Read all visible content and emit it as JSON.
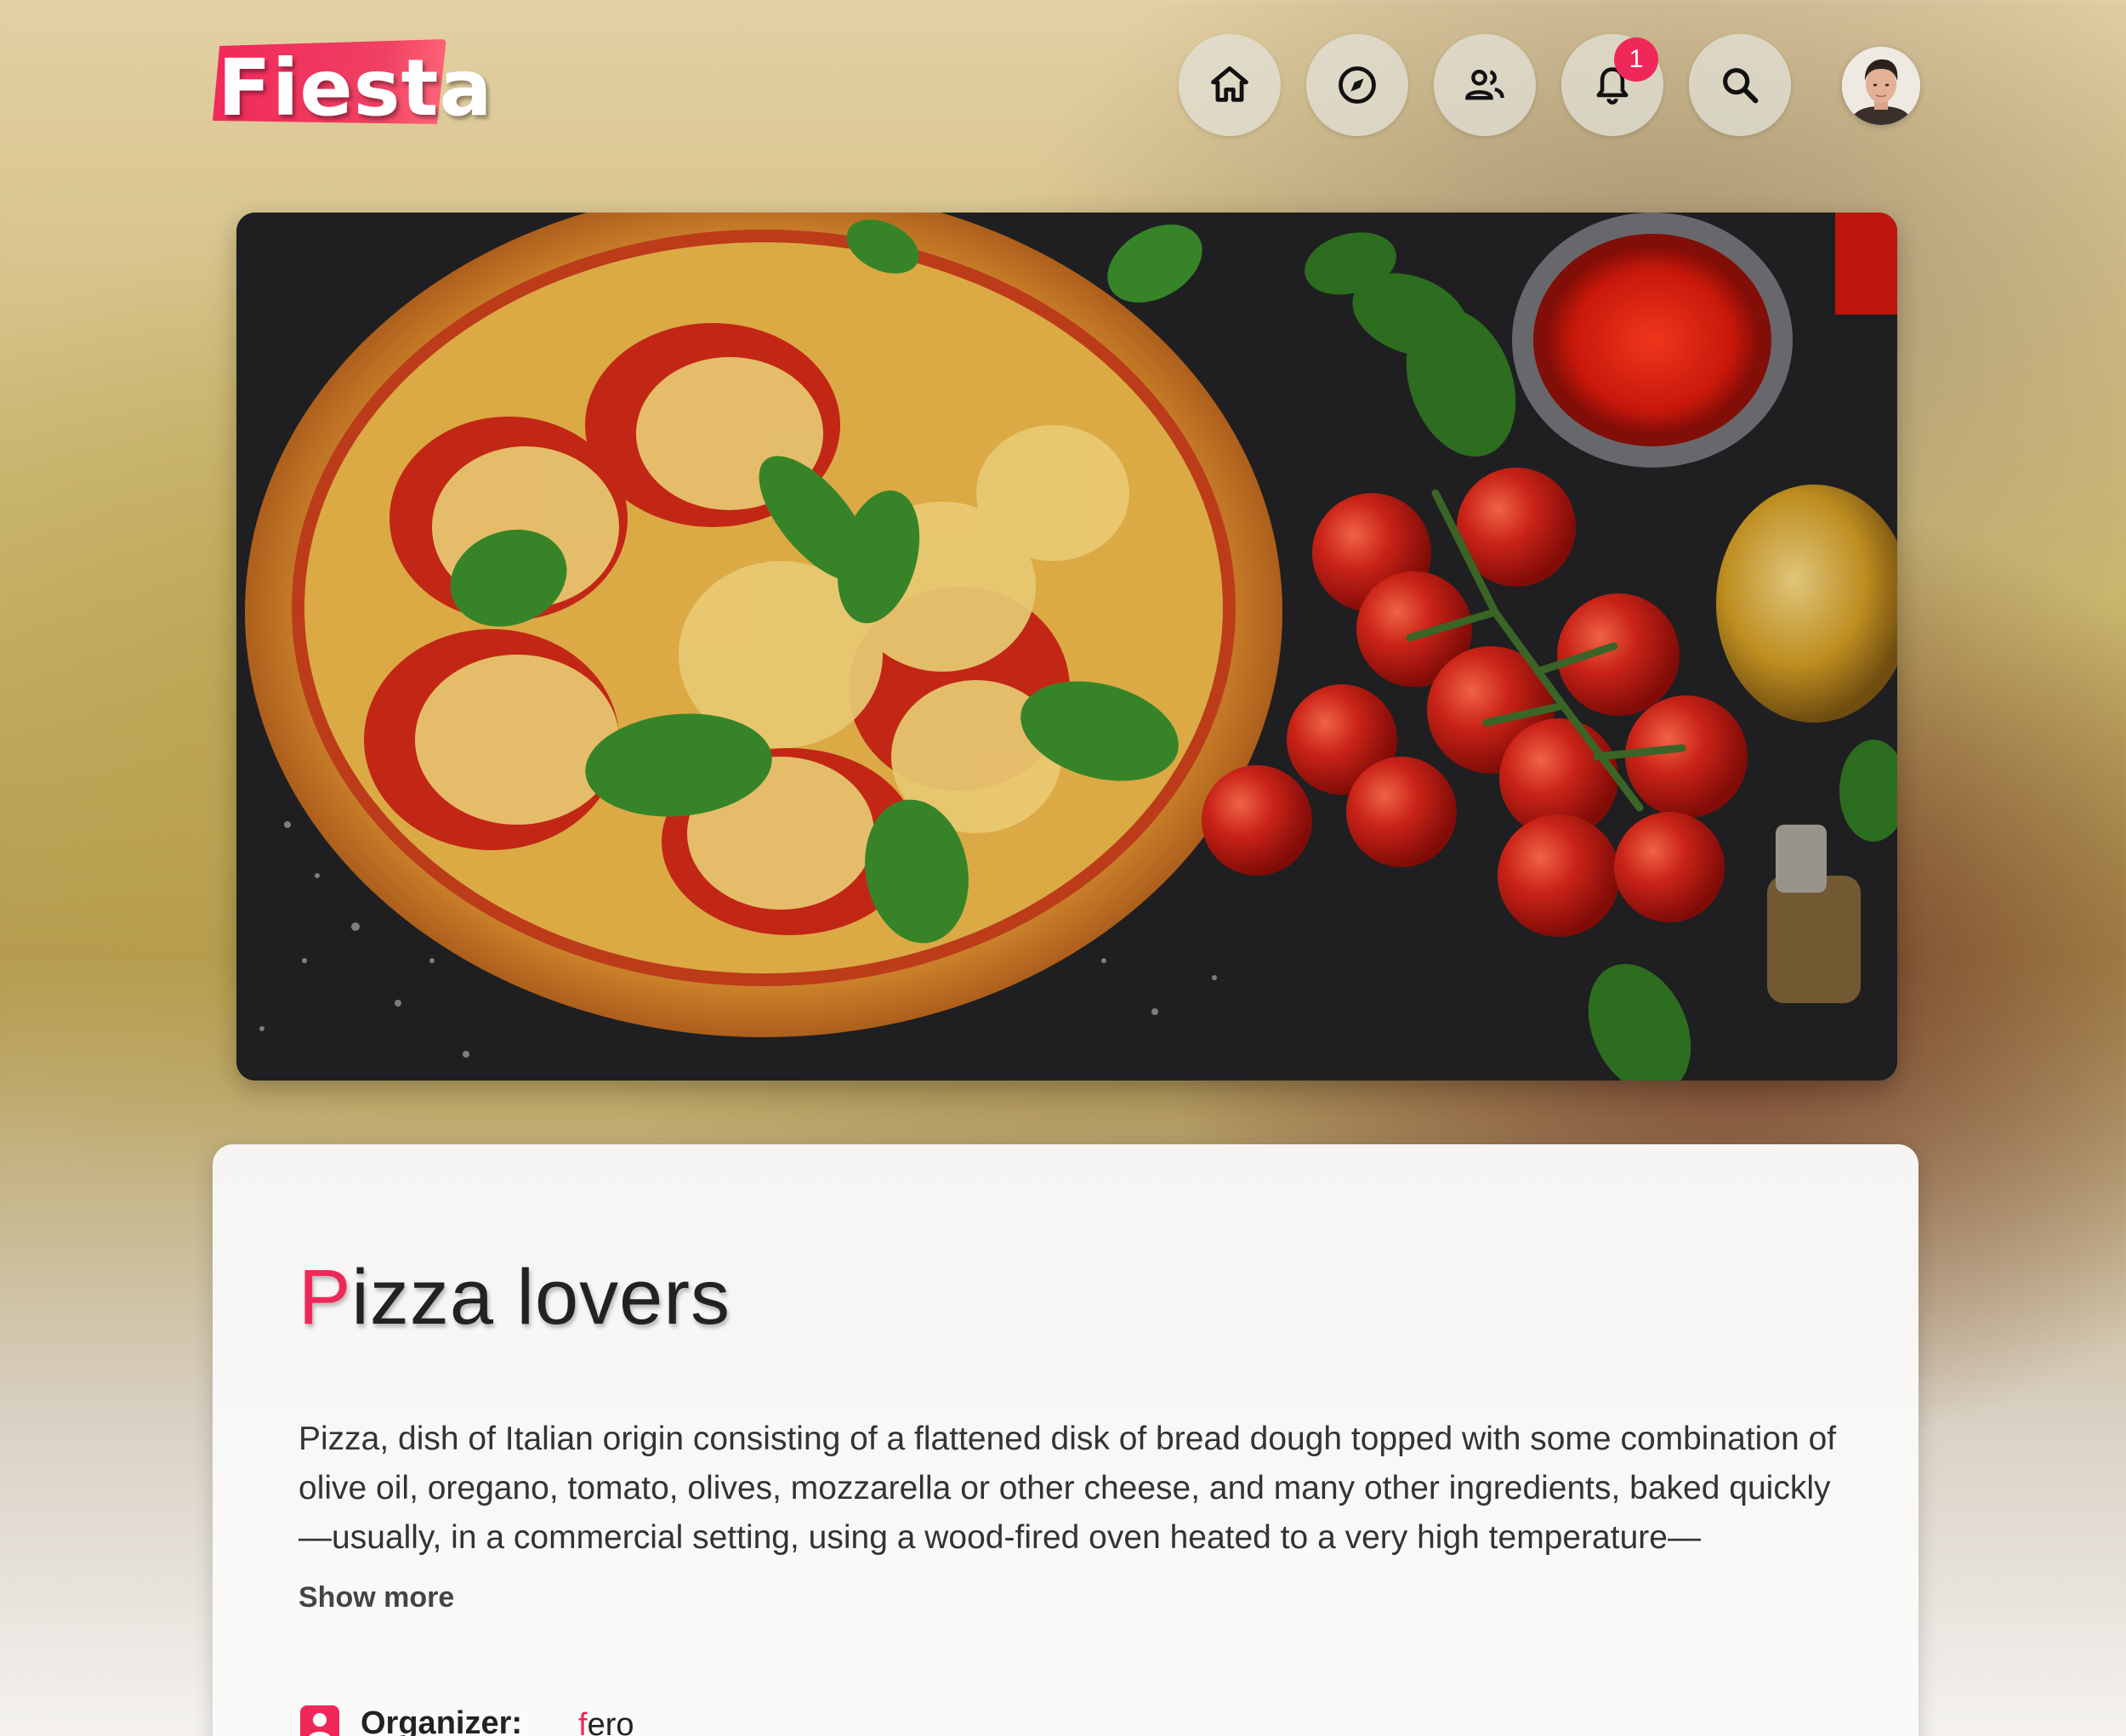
{
  "header": {
    "logo_text": "Fiesta",
    "nav": [
      {
        "icon": "home-icon"
      },
      {
        "icon": "compass-icon"
      },
      {
        "icon": "people-icon"
      },
      {
        "icon": "bell-icon",
        "badge": "1"
      },
      {
        "icon": "search-icon"
      }
    ],
    "avatar": "user-avatar"
  },
  "hero": {
    "image": "pizza-banner-image"
  },
  "event": {
    "title_first": "P",
    "title_rest": "izza lovers",
    "description": "Pizza, dish of Italian origin consisting of a flattened disk of bread dough topped with some combination of olive oil, oregano, tomato, olives, mozzarella or other cheese, and many other ingredients, baked quickly—usually, in a commercial setting, using a wood-fired oven heated to a very high temperature—",
    "show_more": "Show more",
    "organizer_label": "Organizer:",
    "organizer_first": "f",
    "organizer_rest": "ero"
  },
  "colors": {
    "accent": "#f0285a"
  }
}
